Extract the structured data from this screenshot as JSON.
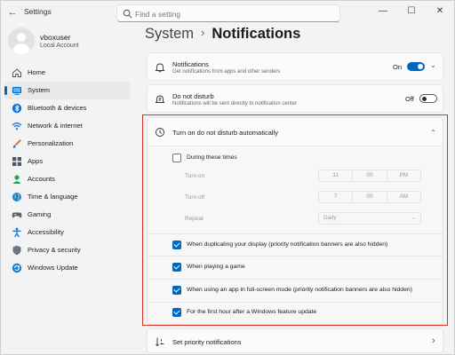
{
  "window": {
    "title": "Settings",
    "back_glyph": "←",
    "minimize_glyph": "—",
    "maximize_glyph": "☐",
    "close_glyph": "✕"
  },
  "search": {
    "placeholder": "Find a setting"
  },
  "user": {
    "name": "vboxuser",
    "account": "Local Account"
  },
  "sidebar": {
    "items": [
      {
        "label": "Home",
        "icon": "home-icon",
        "color": "#555555",
        "active": false
      },
      {
        "label": "System",
        "icon": "system-icon",
        "color": "#0067c0",
        "active": true
      },
      {
        "label": "Bluetooth & devices",
        "icon": "bluetooth-icon",
        "color": "#0a74d8",
        "active": false
      },
      {
        "label": "Network & internet",
        "icon": "wifi-icon",
        "color": "#2d7fd6",
        "active": false
      },
      {
        "label": "Personalization",
        "icon": "brush-icon",
        "color": "#e07b24",
        "active": false
      },
      {
        "label": "Apps",
        "icon": "apps-icon",
        "color": "#4d5966",
        "active": false
      },
      {
        "label": "Accounts",
        "icon": "accounts-icon",
        "color": "#1fa362",
        "active": false
      },
      {
        "label": "Time & language",
        "icon": "globe-icon",
        "color": "#1a7fd0",
        "active": false
      },
      {
        "label": "Gaming",
        "icon": "gaming-icon",
        "color": "#5b6570",
        "active": false
      },
      {
        "label": "Accessibility",
        "icon": "accessibility-icon",
        "color": "#1a6fd6",
        "active": false
      },
      {
        "label": "Privacy & security",
        "icon": "shield-icon",
        "color": "#6b7480",
        "active": false
      },
      {
        "label": "Windows Update",
        "icon": "update-icon",
        "color": "#1a7fd0",
        "active": false
      }
    ]
  },
  "breadcrumb": {
    "parent": "System",
    "separator": "›",
    "current": "Notifications"
  },
  "notifications": {
    "title": "Notifications",
    "subtitle": "Get notifications from apps and other senders",
    "state_label": "On",
    "on": true,
    "chevron": "⌄"
  },
  "do_not_disturb": {
    "title": "Do not disturb",
    "subtitle": "Notifications will be sent directly to notification center",
    "state_label": "Off",
    "on": false
  },
  "auto_dnd": {
    "title": "Turn on do not disturb automatically",
    "chevron": "⌃",
    "during_times": {
      "label": "During these times",
      "checked": false
    },
    "turn_on": {
      "label": "Turn on",
      "hour": "11",
      "minute": "00",
      "period": "PM"
    },
    "turn_off": {
      "label": "Turn off",
      "hour": "7",
      "minute": "00",
      "period": "AM"
    },
    "repeat": {
      "label": "Repeat",
      "value": "Daily",
      "chevron": "⌄"
    },
    "options": [
      {
        "label": "When duplicating your display (priority notification banners are also hidden)",
        "checked": true
      },
      {
        "label": "When playing a game",
        "checked": true
      },
      {
        "label": "When using an app in full-screen mode (priority notification banners are also hidden)",
        "checked": true
      },
      {
        "label": "For the first hour after a Windows feature update",
        "checked": true
      }
    ]
  },
  "priority": {
    "title": "Set priority notifications",
    "chevron": "›"
  },
  "colors": {
    "accent": "#0067c0",
    "highlight_border": "#d93025"
  }
}
